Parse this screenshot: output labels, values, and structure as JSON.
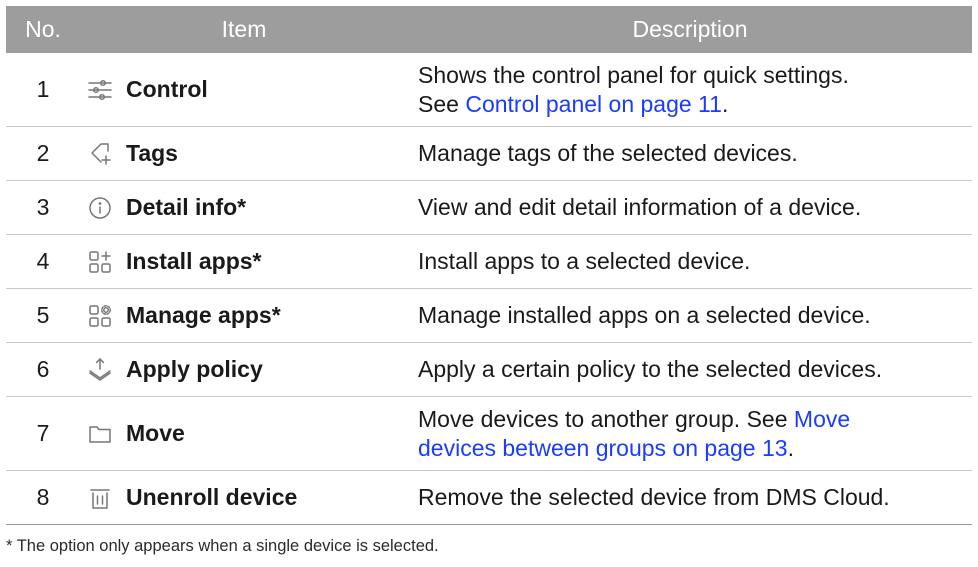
{
  "header": {
    "no": "No.",
    "item": "Item",
    "description": "Description"
  },
  "rows": [
    {
      "no": "1",
      "icon": "sliders-icon",
      "name": "Control",
      "desc": "Shows the control panel for quick settings.",
      "desc2": "See ",
      "link": "Control panel on page 11",
      "after": "."
    },
    {
      "no": "2",
      "icon": "tag-add-icon",
      "name": "Tags",
      "desc": "Manage tags of the selected devices."
    },
    {
      "no": "3",
      "icon": "info-circle-icon",
      "name": "Detail info*",
      "desc": "View and edit detail information of a device."
    },
    {
      "no": "4",
      "icon": "install-apps-icon",
      "name": "Install apps*",
      "desc": "Install apps to a selected device."
    },
    {
      "no": "5",
      "icon": "manage-apps-icon",
      "name": "Manage apps*",
      "desc": "Manage installed apps on a selected device."
    },
    {
      "no": "6",
      "icon": "layers-upload-icon",
      "name": "Apply policy",
      "desc": "Apply a certain policy to the selected devices."
    },
    {
      "no": "7",
      "icon": "folder-icon",
      "name": "Move",
      "desc": "Move devices to another group. See ",
      "link": "Move",
      "desc2": "",
      "link2": "devices between groups on page 13",
      "after": "."
    },
    {
      "no": "8",
      "icon": "trash-icon",
      "name": "Unenroll device",
      "desc": "Remove the selected device from DMS Cloud."
    }
  ],
  "footnote": "* The option only appears when a single device is selected.",
  "colors": {
    "header_bg": "#9d9d9d",
    "link": "#1a3cff"
  }
}
